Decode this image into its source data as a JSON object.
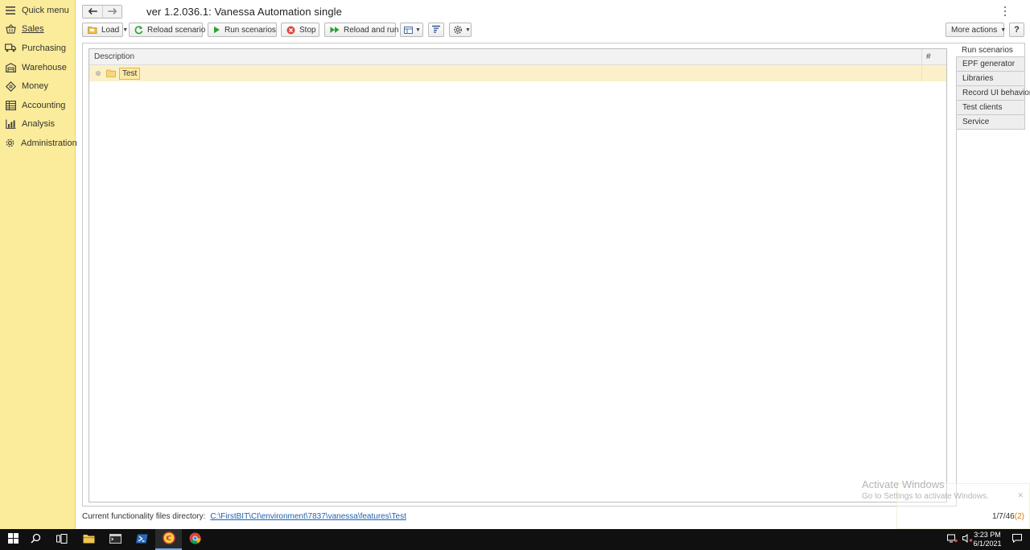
{
  "sidebar": {
    "items": [
      {
        "label": "Quick menu",
        "icon": "hamburger-icon"
      },
      {
        "label": "Sales",
        "icon": "basket-icon",
        "active": true
      },
      {
        "label": "Purchasing",
        "icon": "truck-icon"
      },
      {
        "label": "Warehouse",
        "icon": "warehouse-icon"
      },
      {
        "label": "Money",
        "icon": "money-icon"
      },
      {
        "label": "Accounting",
        "icon": "ledger-icon"
      },
      {
        "label": "Analysis",
        "icon": "chart-icon"
      },
      {
        "label": "Administration",
        "icon": "gear-icon"
      }
    ]
  },
  "header": {
    "title": "ver 1.2.036.1: Vanessa Automation single"
  },
  "toolbar": {
    "load_label": "Load",
    "reload_scenario_label": "Reload scenario",
    "run_scenarios_label": "Run scenarios",
    "stop_label": "Stop",
    "reload_and_run_label": "Reload and run",
    "more_actions_label": "More actions",
    "help_label": "?"
  },
  "grid": {
    "columns": [
      "Description",
      "#"
    ],
    "rows": [
      {
        "label": "Test",
        "expander": "⊕"
      }
    ]
  },
  "tabs": [
    "Run scenarios",
    "EPF generator",
    "Libraries",
    "Record UI behavior",
    "Test clients",
    "Service"
  ],
  "status": {
    "directory_label": "Current functionality files directory:",
    "directory_path": "C:\\FirstBIT\\CI\\environment\\7837\\vanessa\\features\\Test",
    "counter_main": "1/7/46",
    "counter_open": "(",
    "counter_err": "2",
    "counter_close": ")"
  },
  "watermark": {
    "line1": "Activate Windows",
    "line2": "Go to Settings to activate Windows."
  },
  "taskbar": {
    "time": "3:23 PM",
    "date": "6/1/2021"
  },
  "colors": {
    "sidebar_bg": "#fbec9b",
    "row_highlight": "#fbf0c8",
    "link": "#1f5fb0",
    "error_count": "#e07a00"
  }
}
